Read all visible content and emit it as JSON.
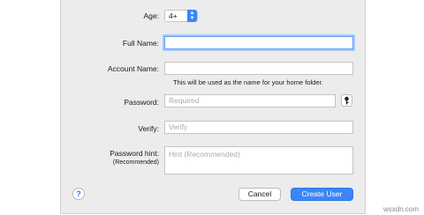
{
  "form": {
    "age_label": "Age:",
    "age_value": "4+",
    "full_name_label": "Full Name:",
    "full_name_value": "",
    "account_name_label": "Account Name:",
    "account_name_value": "",
    "account_note": "This will be used as the name for your home folder.",
    "password_label": "Password:",
    "password_placeholder": "Required",
    "verify_label": "Verify:",
    "verify_placeholder": "Verify",
    "hint_label": "Password hint:",
    "hint_sublabel": "(Recommended)",
    "hint_placeholder": "Hint (Recommended)"
  },
  "buttons": {
    "help": "?",
    "cancel": "Cancel",
    "create": "Create User"
  },
  "watermark": "wsxdn.com",
  "colors": {
    "accent": "#3b86f7",
    "dialog_bg": "#ececec"
  },
  "icons": {
    "key": "key-icon",
    "stepper": "chevron-up-down-icon"
  }
}
